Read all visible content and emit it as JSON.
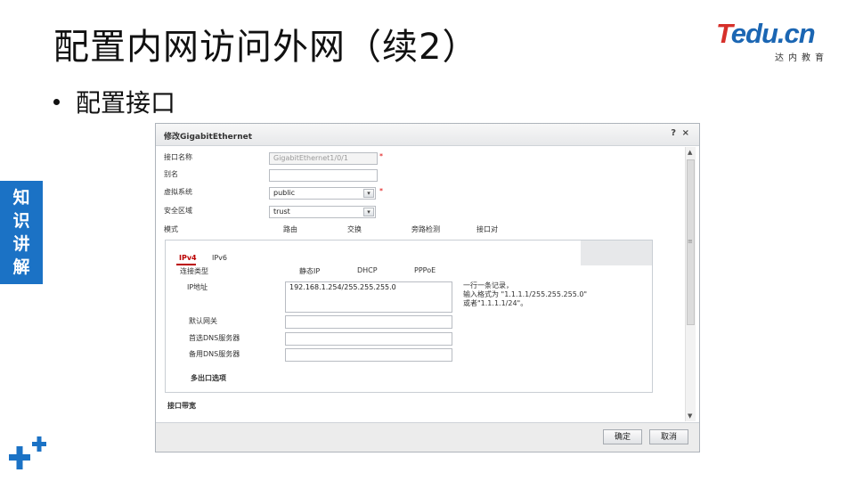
{
  "slide": {
    "title": "配置内网访问外网（续2）",
    "bullet": "配置接口",
    "side_tag": [
      "知",
      "识",
      "讲",
      "解"
    ]
  },
  "logo": {
    "brand_red": "T",
    "brand_blue": "edu.cn",
    "sub": "达内教育",
    "colors": {
      "red": "#d6302a",
      "blue": "#1b66b3"
    }
  },
  "dialog": {
    "title": "修改GigabitEthernet",
    "help": "?",
    "close": "×",
    "fields": {
      "iface_name_label": "接口名称",
      "iface_name_value": "GigabitEthernet1/0/1",
      "alias_label": "别名",
      "alias_value": "",
      "vsys_label": "虚拟系统",
      "vsys_value": "public",
      "zone_label": "安全区域",
      "zone_value": "trust",
      "required_mark": "*"
    },
    "mode": {
      "label": "模式",
      "options": [
        "路由",
        "交换",
        "旁路检测",
        "接口对"
      ]
    },
    "ip_panel": {
      "tabs": [
        "IPv4",
        "IPv6"
      ],
      "conn_type_label": "连接类型",
      "conn_types": [
        "静态IP",
        "DHCP",
        "PPPoE"
      ],
      "ip_label": "IP地址",
      "ip_value": "192.168.1.254/255.255.255.0",
      "hint_lines": [
        "一行一条记录，",
        "输入格式为 \"1.1.1.1/255.255.255.0\"",
        "或者\"1.1.1.1/24\"。"
      ],
      "gateway_label": "默认网关",
      "dns1_label": "首选DNS服务器",
      "dns2_label": "备用DNS服务器",
      "multi_exit_label": "多出口选项"
    },
    "bandwidth_label": "接口带宽",
    "buttons": {
      "ok": "确定",
      "cancel": "取消"
    },
    "scroll": {
      "up": "▲",
      "down": "▼",
      "grip": "≡"
    }
  }
}
